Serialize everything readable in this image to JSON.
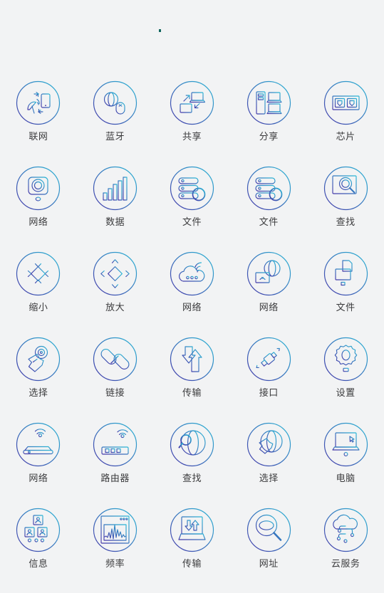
{
  "page": {
    "background_color": "#f2f3f4",
    "label_color": "#3b3b3d",
    "gradient_start_color": "#2ab8d6",
    "gradient_end_color": "#4436a8",
    "marker_dot_color": "#11665e",
    "columns": 5,
    "rows": 6,
    "total_icons": 30
  },
  "icons": [
    {
      "label": "联网",
      "icon_name": "satellite-phone-network-icon"
    },
    {
      "label": "蓝牙",
      "icon_name": "globe-mouse-bluetooth-icon"
    },
    {
      "label": "共享",
      "icon_name": "laptop-monitor-share-icon"
    },
    {
      "label": "分享",
      "icon_name": "server-laptops-share-icon"
    },
    {
      "label": "芯片",
      "icon_name": "dual-chip-module-icon"
    },
    {
      "label": "网络",
      "icon_name": "network-camera-icon"
    },
    {
      "label": "数据",
      "icon_name": "bar-chart-data-icon"
    },
    {
      "label": "文件",
      "icon_name": "database-add-file-icon"
    },
    {
      "label": "文件",
      "icon_name": "database-remove-file-icon"
    },
    {
      "label": "查找",
      "icon_name": "monitor-magnifier-search-icon"
    },
    {
      "label": "缩小",
      "icon_name": "arrows-collapse-shrink-icon"
    },
    {
      "label": "放大",
      "icon_name": "arrows-expand-enlarge-icon"
    },
    {
      "label": "网络",
      "icon_name": "cloud-wifi-network-icon"
    },
    {
      "label": "网络",
      "icon_name": "globe-monitor-network-icon"
    },
    {
      "label": "文件",
      "icon_name": "document-folder-file-icon"
    },
    {
      "label": "选择",
      "icon_name": "hand-click-select-icon"
    },
    {
      "label": "链接",
      "icon_name": "chain-link-icon"
    },
    {
      "label": "传输",
      "icon_name": "up-down-arrows-transfer-icon"
    },
    {
      "label": "接口",
      "icon_name": "plug-connector-interface-icon"
    },
    {
      "label": "设置",
      "icon_name": "gear-settings-icon"
    },
    {
      "label": "网络",
      "icon_name": "wifi-router-network-icon"
    },
    {
      "label": "路由器",
      "icon_name": "router-device-icon"
    },
    {
      "label": "查找",
      "icon_name": "globe-magnifier-search-icon"
    },
    {
      "label": "选择",
      "icon_name": "globe-hand-select-icon"
    },
    {
      "label": "电脑",
      "icon_name": "laptop-cursor-computer-icon"
    },
    {
      "label": "信息",
      "icon_name": "org-chart-contacts-info-icon"
    },
    {
      "label": "频率",
      "icon_name": "waveform-frequency-icon"
    },
    {
      "label": "传输",
      "icon_name": "laptop-updown-transfer-icon"
    },
    {
      "label": "网址",
      "icon_name": "magnifier-url-address-icon"
    },
    {
      "label": "云服务",
      "icon_name": "cloud-circuit-service-icon"
    }
  ]
}
